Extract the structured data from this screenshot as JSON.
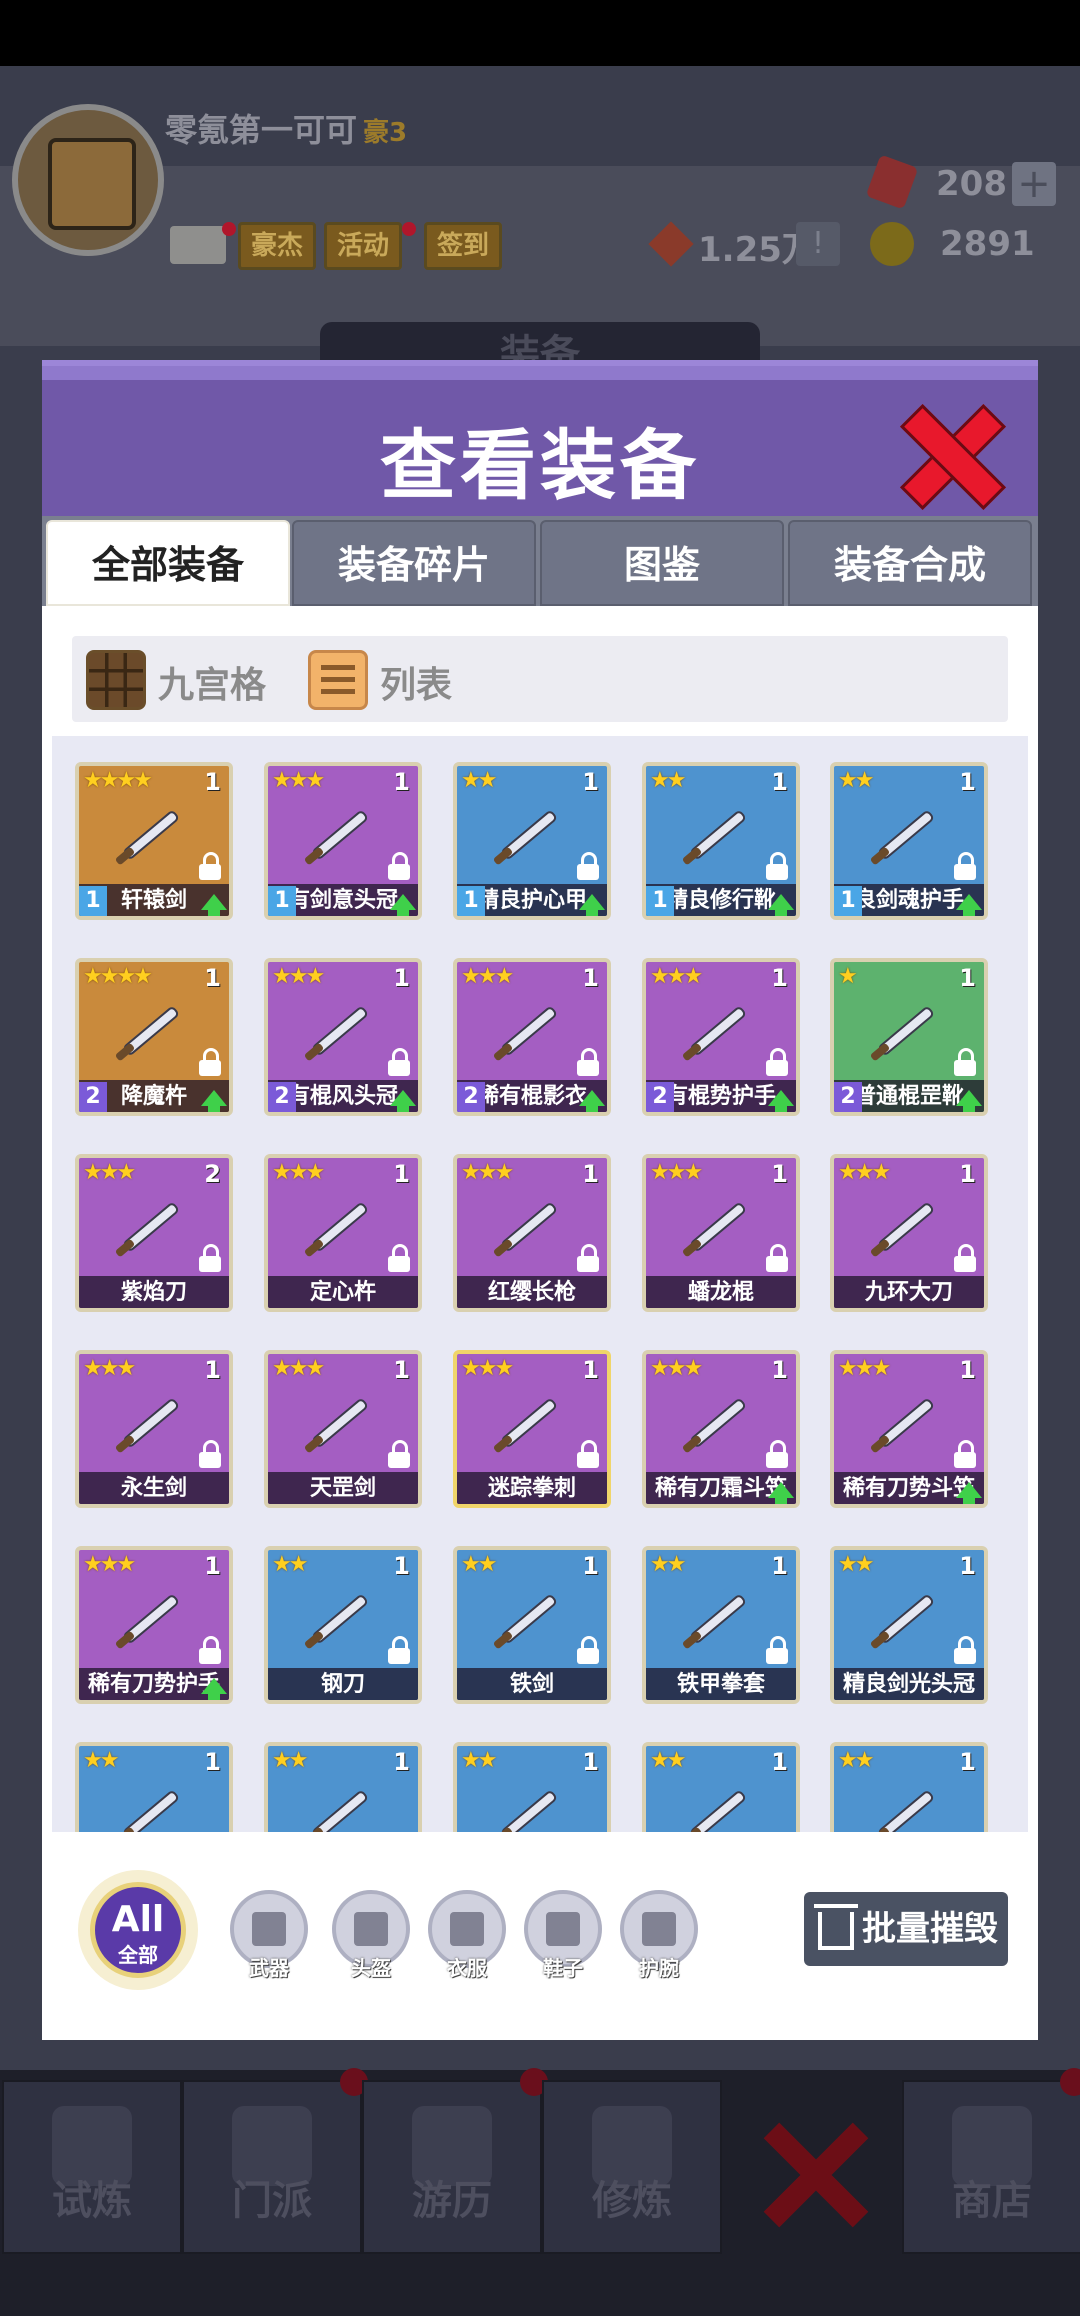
{
  "player": {
    "name": "零氪第一可可",
    "rank": "豪3",
    "buttons": [
      "豪杰",
      "活动",
      "签到"
    ],
    "power": "1.25万",
    "gems": "208",
    "coins": "2891"
  },
  "background_title": "装备",
  "modal": {
    "title": "查看装备",
    "tabs": [
      "全部装备",
      "装备碎片",
      "图鉴",
      "装备合成"
    ],
    "active_tab": 0,
    "view_modes": [
      "九宫格",
      "列表"
    ]
  },
  "items": [
    {
      "name": "轩辕剑",
      "stars": 4,
      "count": "1",
      "level": "1",
      "rarity": "gold",
      "upgrade": true,
      "locked": true
    },
    {
      "name": "有剑意头冠",
      "stars": 3,
      "count": "1",
      "level": "1",
      "rarity": "purple",
      "upgrade": true,
      "locked": true
    },
    {
      "name": "精良护心甲",
      "stars": 2,
      "count": "1",
      "level": "1",
      "rarity": "blue",
      "upgrade": true,
      "locked": true
    },
    {
      "name": "精良修行靴",
      "stars": 2,
      "count": "1",
      "level": "1",
      "rarity": "blue",
      "upgrade": true,
      "locked": true
    },
    {
      "name": "良剑魂护手",
      "stars": 2,
      "count": "1",
      "level": "1",
      "rarity": "blue",
      "upgrade": true,
      "locked": true
    },
    {
      "name": "降魔杵",
      "stars": 4,
      "count": "1",
      "level": "2",
      "rarity": "gold",
      "upgrade": true,
      "locked": true
    },
    {
      "name": "有棍风头冠",
      "stars": 3,
      "count": "1",
      "level": "2",
      "rarity": "purple",
      "upgrade": true,
      "locked": true
    },
    {
      "name": "稀有棍影衣",
      "stars": 3,
      "count": "1",
      "level": "2",
      "rarity": "purple",
      "upgrade": true,
      "locked": true
    },
    {
      "name": "有棍势护手",
      "stars": 3,
      "count": "1",
      "level": "2",
      "rarity": "purple",
      "upgrade": true,
      "locked": true
    },
    {
      "name": "普通棍罡靴",
      "stars": 1,
      "count": "1",
      "level": "2",
      "rarity": "green",
      "upgrade": true,
      "locked": true
    },
    {
      "name": "紫焰刀",
      "stars": 3,
      "count": "2",
      "level": "",
      "rarity": "purple",
      "upgrade": false,
      "locked": true
    },
    {
      "name": "定心杵",
      "stars": 3,
      "count": "1",
      "level": "",
      "rarity": "purple",
      "upgrade": false,
      "locked": true
    },
    {
      "name": "红缨长枪",
      "stars": 3,
      "count": "1",
      "level": "",
      "rarity": "purple",
      "upgrade": false,
      "locked": true
    },
    {
      "name": "蟠龙棍",
      "stars": 3,
      "count": "1",
      "level": "",
      "rarity": "purple",
      "upgrade": false,
      "locked": true
    },
    {
      "name": "九环大刀",
      "stars": 3,
      "count": "1",
      "level": "",
      "rarity": "purple",
      "upgrade": false,
      "locked": true
    },
    {
      "name": "永生剑",
      "stars": 3,
      "count": "1",
      "level": "",
      "rarity": "purple",
      "upgrade": false,
      "locked": true
    },
    {
      "name": "天罡剑",
      "stars": 3,
      "count": "1",
      "level": "",
      "rarity": "purple",
      "upgrade": false,
      "locked": true
    },
    {
      "name": "迷踪拳刺",
      "stars": 3,
      "count": "1",
      "level": "",
      "rarity": "purple",
      "upgrade": false,
      "locked": true,
      "selected": true
    },
    {
      "name": "稀有刀霜斗笠",
      "stars": 3,
      "count": "1",
      "level": "",
      "rarity": "purple",
      "upgrade": true,
      "locked": true
    },
    {
      "name": "稀有刀势斗笠",
      "stars": 3,
      "count": "1",
      "level": "",
      "rarity": "purple",
      "upgrade": true,
      "locked": true
    },
    {
      "name": "稀有刀势护手",
      "stars": 3,
      "count": "1",
      "level": "",
      "rarity": "purple",
      "upgrade": true,
      "locked": true
    },
    {
      "name": "钢刀",
      "stars": 2,
      "count": "1",
      "level": "",
      "rarity": "blue",
      "upgrade": false,
      "locked": true
    },
    {
      "name": "铁剑",
      "stars": 2,
      "count": "1",
      "level": "",
      "rarity": "blue",
      "upgrade": false,
      "locked": true
    },
    {
      "name": "铁甲拳套",
      "stars": 2,
      "count": "1",
      "level": "",
      "rarity": "blue",
      "upgrade": false,
      "locked": true
    },
    {
      "name": "精良剑光头冠",
      "stars": 2,
      "count": "1",
      "level": "",
      "rarity": "blue",
      "upgrade": false,
      "locked": true
    },
    {
      "name": "",
      "stars": 2,
      "count": "1",
      "level": "",
      "rarity": "blue",
      "upgrade": false,
      "locked": false
    },
    {
      "name": "",
      "stars": 2,
      "count": "1",
      "level": "",
      "rarity": "blue",
      "upgrade": false,
      "locked": false
    },
    {
      "name": "",
      "stars": 2,
      "count": "1",
      "level": "",
      "rarity": "blue",
      "upgrade": false,
      "locked": false
    },
    {
      "name": "",
      "stars": 2,
      "count": "1",
      "level": "",
      "rarity": "blue",
      "upgrade": false,
      "locked": false
    },
    {
      "name": "",
      "stars": 2,
      "count": "1",
      "level": "",
      "rarity": "blue",
      "upgrade": false,
      "locked": false
    }
  ],
  "filters": {
    "all_top": "All",
    "all_bottom": "全部",
    "categories": [
      "武器",
      "头盔",
      "衣服",
      "鞋子",
      "护腕"
    ]
  },
  "batch_destroy": "批量摧毁",
  "bottom_nav": [
    "试炼",
    "门派",
    "游历",
    "修炼",
    "商店"
  ],
  "colors": {
    "header": "#7058a8",
    "gold": "#c98a3c",
    "purple": "#a45ec2",
    "blue": "#4e93cf",
    "green": "#5db26e",
    "close": "#e8182c"
  }
}
